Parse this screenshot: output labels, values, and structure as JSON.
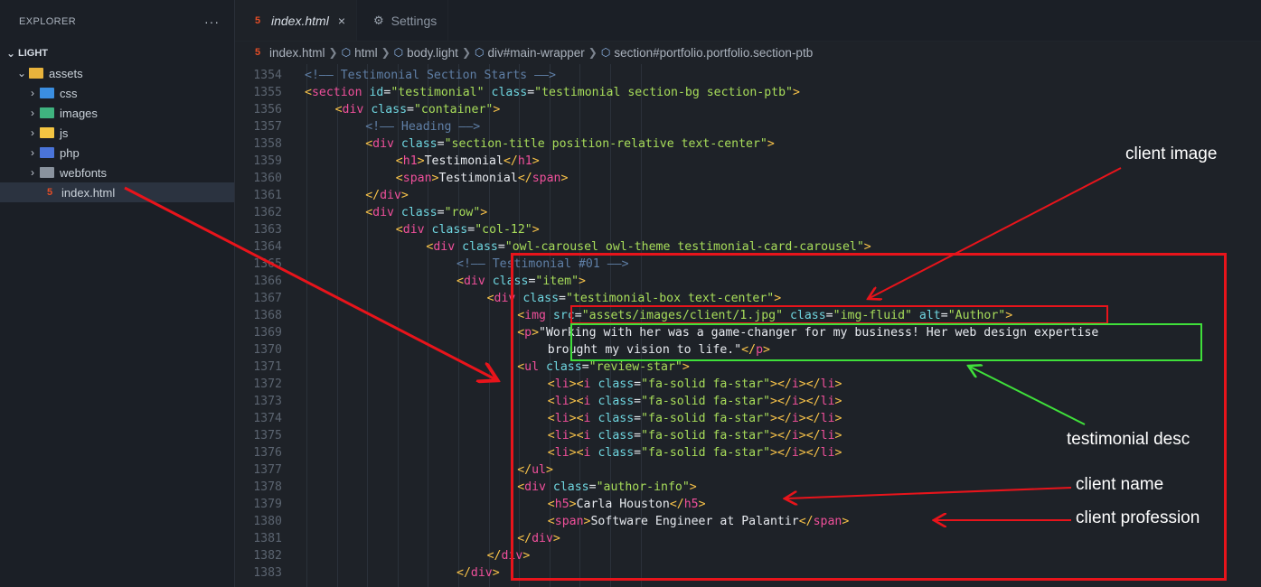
{
  "explorer": {
    "title": "EXPLORER",
    "more": "···",
    "root": "LIGHT",
    "items": [
      {
        "label": "assets",
        "kind": "folder-open",
        "color": "#e8b33c"
      },
      {
        "label": "css",
        "kind": "folder",
        "color": "#3b8ee0"
      },
      {
        "label": "images",
        "kind": "folder",
        "color": "#3fb37f"
      },
      {
        "label": "js",
        "kind": "folder",
        "color": "#f4c542"
      },
      {
        "label": "php",
        "kind": "folder",
        "color": "#4a74d9"
      },
      {
        "label": "webfonts",
        "kind": "folder",
        "color": "#8a939e"
      },
      {
        "label": "index.html",
        "kind": "html-file",
        "color": "#e44d26"
      }
    ]
  },
  "tabs": [
    {
      "label": "index.html",
      "icon": "html5-icon",
      "close": "×"
    },
    {
      "label": "Settings",
      "icon": "settings-icon"
    }
  ],
  "breadcrumb": [
    "index.html",
    "html",
    "body.light",
    "div#main-wrapper",
    "section#portfolio.portfolio.section-ptb"
  ],
  "editor": {
    "lines": [
      {
        "n": "1354",
        "indent": 4,
        "tokens": [
          [
            "cm",
            "<!—— Testimonial Section Starts ——>"
          ]
        ]
      },
      {
        "n": "1355",
        "indent": 4,
        "tokens": [
          [
            "tag",
            "<"
          ],
          [
            "name",
            "section"
          ],
          [
            "sp",
            " "
          ],
          [
            "attr",
            "id"
          ],
          [
            "eq",
            "="
          ],
          [
            "str",
            "\"testimonial\""
          ],
          [
            "sp",
            " "
          ],
          [
            "attr",
            "class"
          ],
          [
            "eq",
            "="
          ],
          [
            "str",
            "\"testimonial section-bg section-ptb\""
          ],
          [
            "tag",
            ">"
          ]
        ]
      },
      {
        "n": "1356",
        "indent": 5,
        "tokens": [
          [
            "tag",
            "<"
          ],
          [
            "name",
            "div"
          ],
          [
            "sp",
            " "
          ],
          [
            "attr",
            "class"
          ],
          [
            "eq",
            "="
          ],
          [
            "str",
            "\"container\""
          ],
          [
            "tag",
            ">"
          ]
        ]
      },
      {
        "n": "1357",
        "indent": 6,
        "tokens": [
          [
            "cm",
            "<!—— Heading ——>"
          ]
        ]
      },
      {
        "n": "1358",
        "indent": 6,
        "tokens": [
          [
            "tag",
            "<"
          ],
          [
            "name",
            "div"
          ],
          [
            "sp",
            " "
          ],
          [
            "attr",
            "class"
          ],
          [
            "eq",
            "="
          ],
          [
            "str",
            "\"section-title position-relative text-center\""
          ],
          [
            "tag",
            ">"
          ]
        ]
      },
      {
        "n": "1359",
        "indent": 7,
        "tokens": [
          [
            "tag",
            "<"
          ],
          [
            "name",
            "h1"
          ],
          [
            "tag",
            ">"
          ],
          [
            "text",
            "Testimonial"
          ],
          [
            "tag",
            "</"
          ],
          [
            "name",
            "h1"
          ],
          [
            "tag",
            ">"
          ]
        ]
      },
      {
        "n": "1360",
        "indent": 7,
        "tokens": [
          [
            "tag",
            "<"
          ],
          [
            "name",
            "span"
          ],
          [
            "tag",
            ">"
          ],
          [
            "text",
            "Testimonial"
          ],
          [
            "tag",
            "</"
          ],
          [
            "name",
            "span"
          ],
          [
            "tag",
            ">"
          ]
        ]
      },
      {
        "n": "1361",
        "indent": 6,
        "tokens": [
          [
            "tag",
            "</"
          ],
          [
            "name",
            "div"
          ],
          [
            "tag",
            ">"
          ]
        ]
      },
      {
        "n": "1362",
        "indent": 6,
        "tokens": [
          [
            "tag",
            "<"
          ],
          [
            "name",
            "div"
          ],
          [
            "sp",
            " "
          ],
          [
            "attr",
            "class"
          ],
          [
            "eq",
            "="
          ],
          [
            "str",
            "\"row\""
          ],
          [
            "tag",
            ">"
          ]
        ]
      },
      {
        "n": "1363",
        "indent": 7,
        "tokens": [
          [
            "tag",
            "<"
          ],
          [
            "name",
            "div"
          ],
          [
            "sp",
            " "
          ],
          [
            "attr",
            "class"
          ],
          [
            "eq",
            "="
          ],
          [
            "str",
            "\"col-12\""
          ],
          [
            "tag",
            ">"
          ]
        ]
      },
      {
        "n": "1364",
        "indent": 8,
        "tokens": [
          [
            "tag",
            "<"
          ],
          [
            "name",
            "div"
          ],
          [
            "sp",
            " "
          ],
          [
            "attr",
            "class"
          ],
          [
            "eq",
            "="
          ],
          [
            "str",
            "\"owl-carousel owl-theme testimonial-card-carousel\""
          ],
          [
            "tag",
            ">"
          ]
        ]
      },
      {
        "n": "1365",
        "indent": 9,
        "tokens": [
          [
            "cm",
            "<!—— Testimonial #01 ——>"
          ]
        ]
      },
      {
        "n": "1366",
        "indent": 9,
        "tokens": [
          [
            "tag",
            "<"
          ],
          [
            "name",
            "div"
          ],
          [
            "sp",
            " "
          ],
          [
            "attr",
            "class"
          ],
          [
            "eq",
            "="
          ],
          [
            "str",
            "\"item\""
          ],
          [
            "tag",
            ">"
          ]
        ]
      },
      {
        "n": "1367",
        "indent": 10,
        "tokens": [
          [
            "tag",
            "<"
          ],
          [
            "name",
            "div"
          ],
          [
            "sp",
            " "
          ],
          [
            "attr",
            "class"
          ],
          [
            "eq",
            "="
          ],
          [
            "str",
            "\"testimonial-box text-center\""
          ],
          [
            "tag",
            ">"
          ]
        ]
      },
      {
        "n": "1368",
        "indent": 11,
        "tokens": [
          [
            "tag",
            "<"
          ],
          [
            "name",
            "img"
          ],
          [
            "sp",
            " "
          ],
          [
            "attr",
            "src"
          ],
          [
            "eq",
            "="
          ],
          [
            "str",
            "\"assets/images/client/1.jpg\""
          ],
          [
            "sp",
            " "
          ],
          [
            "attr",
            "class"
          ],
          [
            "eq",
            "="
          ],
          [
            "str",
            "\"img-fluid\""
          ],
          [
            "sp",
            " "
          ],
          [
            "attr",
            "alt"
          ],
          [
            "eq",
            "="
          ],
          [
            "str",
            "\"Author\""
          ],
          [
            "tag",
            ">"
          ]
        ]
      },
      {
        "n": "1369",
        "indent": 11,
        "tokens": [
          [
            "tag",
            "<"
          ],
          [
            "name",
            "p"
          ],
          [
            "tag",
            ">"
          ],
          [
            "text",
            "\"Working with her was a game-changer for my business! Her web design expertise"
          ]
        ]
      },
      {
        "n": "1370",
        "indent": 12,
        "tokens": [
          [
            "text",
            "brought my vision to life.\""
          ],
          [
            "tag",
            "</"
          ],
          [
            "name",
            "p"
          ],
          [
            "tag",
            ">"
          ]
        ]
      },
      {
        "n": "1371",
        "indent": 11,
        "tokens": [
          [
            "tag",
            "<"
          ],
          [
            "name",
            "ul"
          ],
          [
            "sp",
            " "
          ],
          [
            "attr",
            "class"
          ],
          [
            "eq",
            "="
          ],
          [
            "str",
            "\"review-star\""
          ],
          [
            "tag",
            ">"
          ]
        ]
      },
      {
        "n": "1372",
        "indent": 12,
        "tokens": [
          [
            "tag",
            "<"
          ],
          [
            "name",
            "li"
          ],
          [
            "tag",
            "><"
          ],
          [
            "name",
            "i"
          ],
          [
            "sp",
            " "
          ],
          [
            "attr",
            "class"
          ],
          [
            "eq",
            "="
          ],
          [
            "str",
            "\"fa-solid fa-star\""
          ],
          [
            "tag",
            "></"
          ],
          [
            "name",
            "i"
          ],
          [
            "tag",
            "></"
          ],
          [
            "name",
            "li"
          ],
          [
            "tag",
            ">"
          ]
        ]
      },
      {
        "n": "1373",
        "indent": 12,
        "tokens": [
          [
            "tag",
            "<"
          ],
          [
            "name",
            "li"
          ],
          [
            "tag",
            "><"
          ],
          [
            "name",
            "i"
          ],
          [
            "sp",
            " "
          ],
          [
            "attr",
            "class"
          ],
          [
            "eq",
            "="
          ],
          [
            "str",
            "\"fa-solid fa-star\""
          ],
          [
            "tag",
            "></"
          ],
          [
            "name",
            "i"
          ],
          [
            "tag",
            "></"
          ],
          [
            "name",
            "li"
          ],
          [
            "tag",
            ">"
          ]
        ]
      },
      {
        "n": "1374",
        "indent": 12,
        "tokens": [
          [
            "tag",
            "<"
          ],
          [
            "name",
            "li"
          ],
          [
            "tag",
            "><"
          ],
          [
            "name",
            "i"
          ],
          [
            "sp",
            " "
          ],
          [
            "attr",
            "class"
          ],
          [
            "eq",
            "="
          ],
          [
            "str",
            "\"fa-solid fa-star\""
          ],
          [
            "tag",
            "></"
          ],
          [
            "name",
            "i"
          ],
          [
            "tag",
            "></"
          ],
          [
            "name",
            "li"
          ],
          [
            "tag",
            ">"
          ]
        ]
      },
      {
        "n": "1375",
        "indent": 12,
        "tokens": [
          [
            "tag",
            "<"
          ],
          [
            "name",
            "li"
          ],
          [
            "tag",
            "><"
          ],
          [
            "name",
            "i"
          ],
          [
            "sp",
            " "
          ],
          [
            "attr",
            "class"
          ],
          [
            "eq",
            "="
          ],
          [
            "str",
            "\"fa-solid fa-star\""
          ],
          [
            "tag",
            "></"
          ],
          [
            "name",
            "i"
          ],
          [
            "tag",
            "></"
          ],
          [
            "name",
            "li"
          ],
          [
            "tag",
            ">"
          ]
        ]
      },
      {
        "n": "1376",
        "indent": 12,
        "tokens": [
          [
            "tag",
            "<"
          ],
          [
            "name",
            "li"
          ],
          [
            "tag",
            "><"
          ],
          [
            "name",
            "i"
          ],
          [
            "sp",
            " "
          ],
          [
            "attr",
            "class"
          ],
          [
            "eq",
            "="
          ],
          [
            "str",
            "\"fa-solid fa-star\""
          ],
          [
            "tag",
            "></"
          ],
          [
            "name",
            "i"
          ],
          [
            "tag",
            "></"
          ],
          [
            "name",
            "li"
          ],
          [
            "tag",
            ">"
          ]
        ]
      },
      {
        "n": "1377",
        "indent": 11,
        "tokens": [
          [
            "tag",
            "</"
          ],
          [
            "name",
            "ul"
          ],
          [
            "tag",
            ">"
          ]
        ]
      },
      {
        "n": "1378",
        "indent": 11,
        "tokens": [
          [
            "tag",
            "<"
          ],
          [
            "name",
            "div"
          ],
          [
            "sp",
            " "
          ],
          [
            "attr",
            "class"
          ],
          [
            "eq",
            "="
          ],
          [
            "str",
            "\"author-info\""
          ],
          [
            "tag",
            ">"
          ]
        ]
      },
      {
        "n": "1379",
        "indent": 12,
        "tokens": [
          [
            "tag",
            "<"
          ],
          [
            "name",
            "h5"
          ],
          [
            "tag",
            ">"
          ],
          [
            "text",
            "Carla Houston"
          ],
          [
            "tag",
            "</"
          ],
          [
            "name",
            "h5"
          ],
          [
            "tag",
            ">"
          ]
        ]
      },
      {
        "n": "1380",
        "indent": 12,
        "tokens": [
          [
            "tag",
            "<"
          ],
          [
            "name",
            "span"
          ],
          [
            "tag",
            ">"
          ],
          [
            "text",
            "Software Engineer at Palantir"
          ],
          [
            "tag",
            "</"
          ],
          [
            "name",
            "span"
          ],
          [
            "tag",
            ">"
          ]
        ]
      },
      {
        "n": "1381",
        "indent": 11,
        "tokens": [
          [
            "tag",
            "</"
          ],
          [
            "name",
            "div"
          ],
          [
            "tag",
            ">"
          ]
        ]
      },
      {
        "n": "1382",
        "indent": 10,
        "tokens": [
          [
            "tag",
            "</"
          ],
          [
            "name",
            "div"
          ],
          [
            "tag",
            ">"
          ]
        ]
      },
      {
        "n": "1383",
        "indent": 9,
        "tokens": [
          [
            "tag",
            "</"
          ],
          [
            "name",
            "div"
          ],
          [
            "tag",
            ">"
          ]
        ]
      }
    ]
  },
  "annotations": {
    "labels": [
      "client image",
      "testimonial desc",
      "client name",
      "client profession"
    ],
    "red": "#e8141b",
    "green": "#3fe03a"
  },
  "colors": {
    "tag": "#f9c349",
    "name": "#f0509b",
    "attr": "#6fd6e0",
    "string": "#a8dd5a",
    "comment": "#5f7fa6",
    "text": "#e7eaef"
  }
}
